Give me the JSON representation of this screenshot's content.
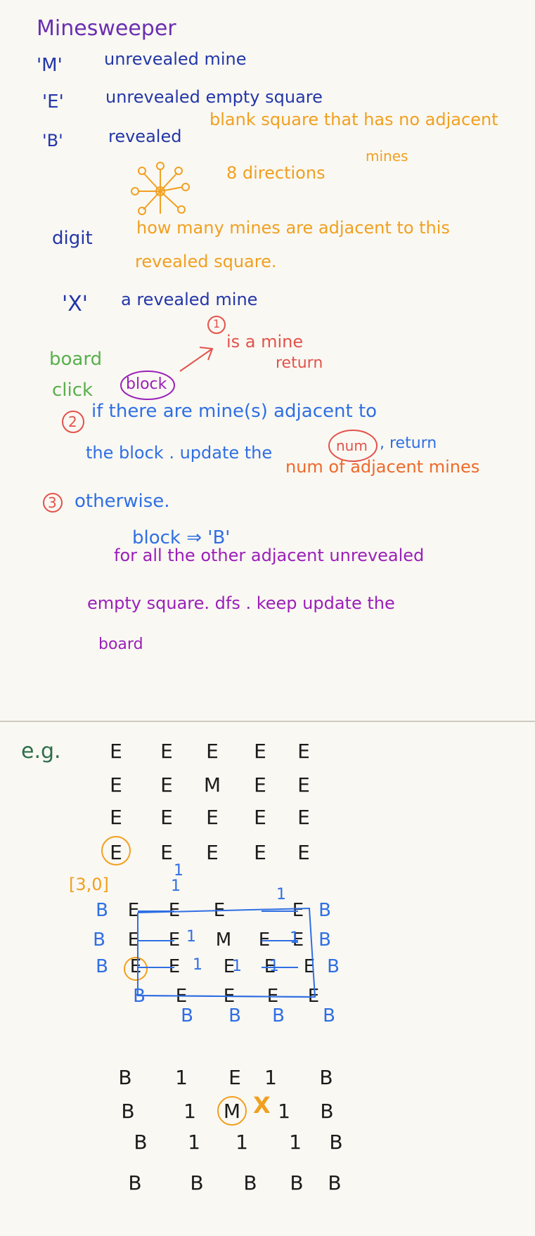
{
  "title": "Minesweeper",
  "legend": {
    "m_key": "'M'",
    "m_desc": "unrevealed mine",
    "e_key": "'E'",
    "e_desc": "unrevealed empty square",
    "b_key": "'B'",
    "b_word": "revealed",
    "b_desc": "blank square that has no adjacent",
    "b_desc2": "mines",
    "directions": "8 directions",
    "digit_key": "digit",
    "digit_desc1": "how many mines are adjacent to this",
    "digit_desc2": "revealed square.",
    "x_key": "'X'",
    "x_desc": "a revealed mine"
  },
  "rules": {
    "board": "board",
    "click": "click",
    "block": "block",
    "step1_num": "1",
    "step1_a": "is a mine",
    "step1_b": "return",
    "step2_num": "2",
    "step2_a": "if there are mine(s) adjacent to",
    "step2_b": "the block . update the",
    "step2_num_word": "num",
    "step2_return": ", return",
    "step2_c": "num of adjacent mines",
    "step3_num": "3",
    "step3_a": "otherwise.",
    "step3_b": "block ⇒ 'B'",
    "step3_c": "for all the other adjacent unrevealed",
    "step3_d": "empty square. dfs . keep update the",
    "step3_e": "board"
  },
  "example": {
    "label": "e.g.",
    "initial_board": [
      [
        "E",
        "E",
        "E",
        "E",
        "E"
      ],
      [
        "E",
        "E",
        "M",
        "E",
        "E"
      ],
      [
        "E",
        "E",
        "E",
        "E",
        "E"
      ],
      [
        "E",
        "E",
        "E",
        "E",
        "E"
      ]
    ],
    "click_label": "[3,0]",
    "trace_grid": [
      [
        "B",
        "E",
        "E",
        "E",
        "E",
        "B"
      ],
      [
        "B",
        "E",
        "E",
        "M",
        "E",
        "E",
        "B"
      ],
      [
        "B",
        "E",
        "E",
        "E",
        "E",
        "E",
        "B"
      ],
      [
        "B",
        "E",
        "E",
        "E",
        "E"
      ]
    ],
    "trace_ones": [
      "1",
      "1",
      "1",
      "1",
      "1",
      "1",
      "1",
      "1"
    ],
    "trace_bottom_bs": [
      "B",
      "B",
      "B",
      "B"
    ],
    "final_board": [
      [
        "B",
        "1",
        "E",
        "1",
        "B"
      ],
      [
        "B",
        "1",
        "M",
        "1",
        "B"
      ],
      [
        "B",
        "1",
        "1",
        "1",
        "B"
      ],
      [
        "B",
        "B",
        "B",
        "B",
        "B"
      ]
    ],
    "x_mark": "X"
  },
  "colors": {
    "background": "#faf8f3",
    "purple": "#6a2fb0",
    "navy": "#2337a8",
    "blue": "#2f6fe3",
    "orange": "#f0a020",
    "red": "#e2534b",
    "green": "#58b04c",
    "magenta": "#9a1fb8"
  }
}
